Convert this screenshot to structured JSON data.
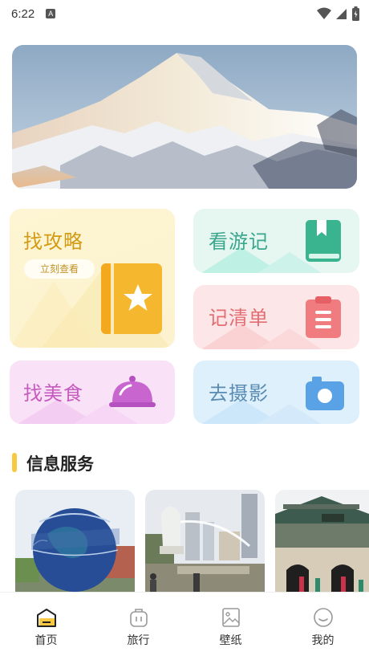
{
  "status_bar": {
    "time": "6:22",
    "notification_badge": "A"
  },
  "cards": {
    "guide": {
      "title": "找攻略",
      "button": "立刻查看"
    },
    "travel_notes": {
      "title": "看游记"
    },
    "checklist": {
      "title": "记清单"
    },
    "food": {
      "title": "找美食"
    },
    "photography": {
      "title": "去摄影"
    }
  },
  "section": {
    "title": "信息服务"
  },
  "nav": {
    "items": [
      {
        "label": "首页",
        "icon": "home-icon",
        "active": true
      },
      {
        "label": "旅行",
        "icon": "luggage-icon",
        "active": false
      },
      {
        "label": "壁纸",
        "icon": "picture-icon",
        "active": false
      },
      {
        "label": "我的",
        "icon": "smile-icon",
        "active": false
      }
    ]
  },
  "colors": {
    "accent": "#f8c840",
    "guide": "#d39b13",
    "travel": "#3aa68c",
    "list": "#e26d72",
    "food": "#c65bbe",
    "photo": "#5a8bb2"
  }
}
